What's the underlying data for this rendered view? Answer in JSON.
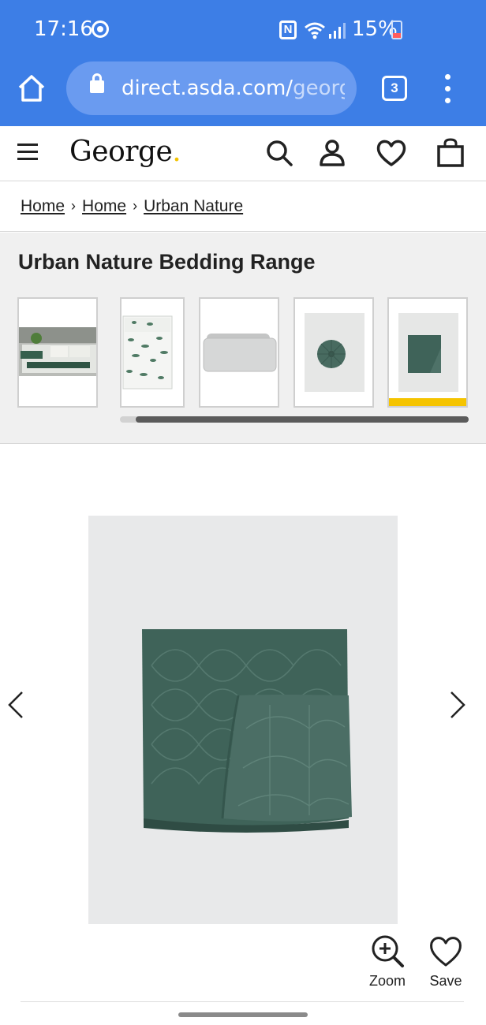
{
  "status_bar": {
    "time": "17:16",
    "battery": "15%",
    "icons": [
      "sync-icon",
      "nfc-icon",
      "wifi-icon",
      "signal-icon",
      "battery-icon"
    ]
  },
  "browser": {
    "url_host": "direct.asda.com/",
    "url_rest": "george",
    "tab_count": "3"
  },
  "header": {
    "logo": "George",
    "logo_dot": ".",
    "icons": [
      "menu-icon",
      "search-icon",
      "account-icon",
      "wishlist-heart-icon",
      "bag-icon"
    ]
  },
  "breadcrumb": {
    "items": [
      "Home",
      "Home",
      "Urban Nature"
    ],
    "separator": "›"
  },
  "range": {
    "title": "Urban Nature Bedding Range",
    "thumbnails": [
      "bed-scene",
      "duvet-set",
      "pillow-pair",
      "round-cushion",
      "quilted-throw"
    ],
    "active_index": 4
  },
  "product": {
    "zoom_label": "Zoom",
    "save_label": "Save"
  },
  "colors": {
    "browser_blue": "#3d7ee6",
    "accent_yellow": "#f5c400",
    "throw_green": "#3f6359"
  }
}
